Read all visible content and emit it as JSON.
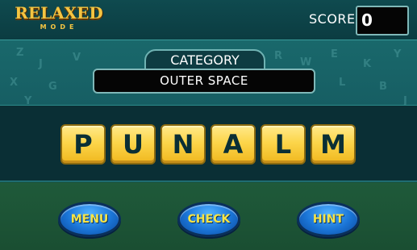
{
  "header": {
    "logo_main": "RELAXED",
    "logo_sub": "MODE",
    "score_label": "SCORE",
    "score_value": "0"
  },
  "category": {
    "label": "CATEGORY",
    "value": "OUTER SPACE"
  },
  "tiles": [
    "P",
    "U",
    "N",
    "A",
    "L",
    "M"
  ],
  "buttons": {
    "menu": "MENU",
    "check": "CHECK",
    "hint": "HINT"
  },
  "colors": {
    "tile": "#fcd54a",
    "button": "#1a74d6",
    "button_text": "#f6e447",
    "logo": "#f4c542"
  }
}
